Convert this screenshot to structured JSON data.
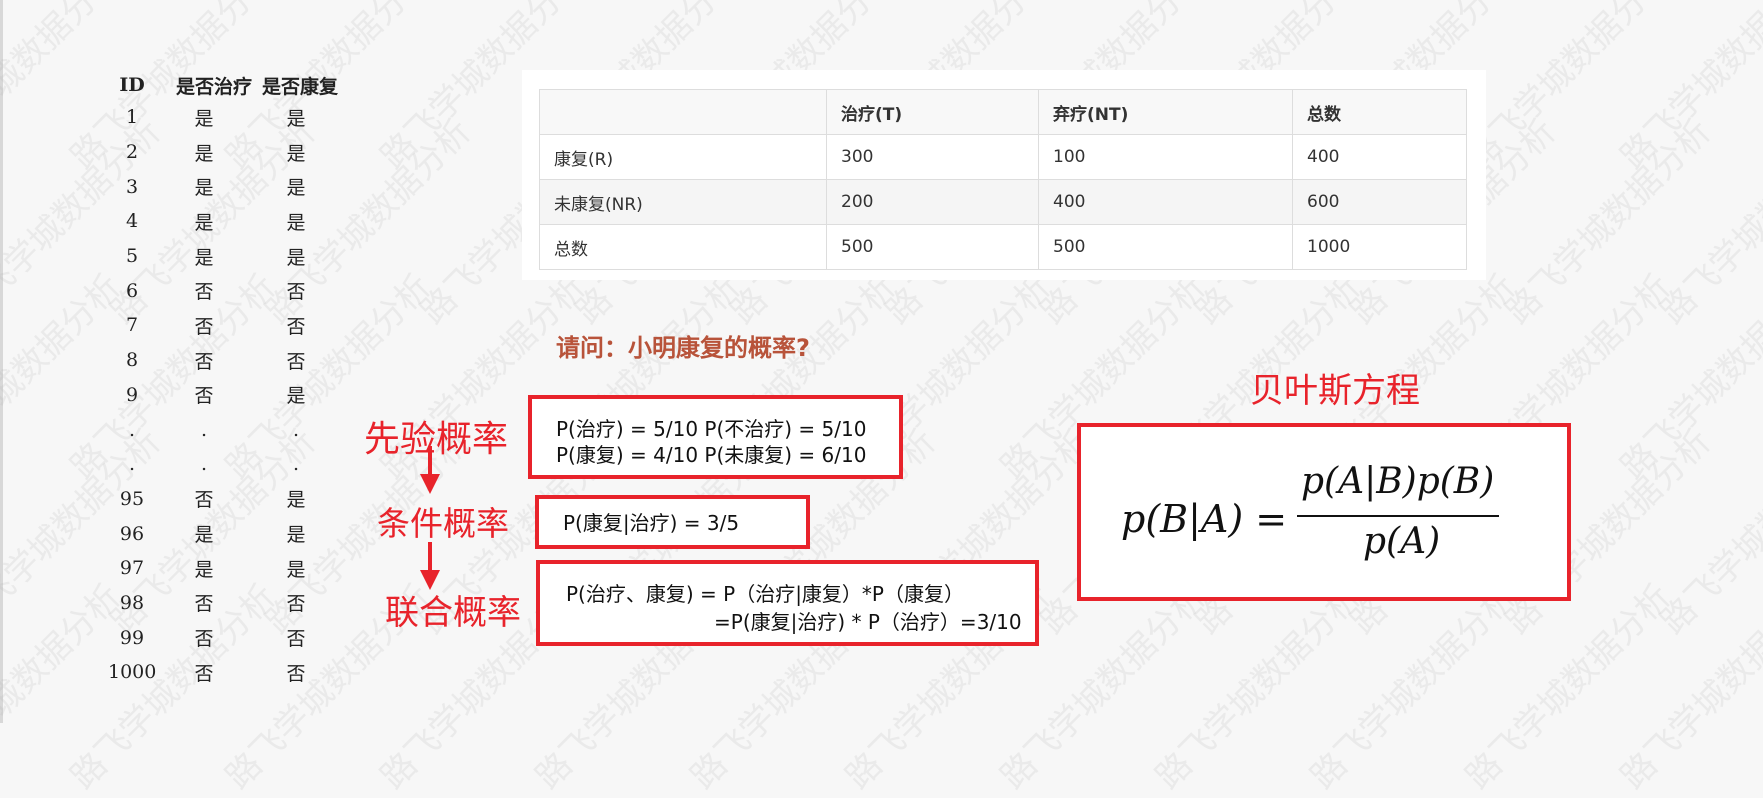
{
  "id_table": {
    "headers": [
      "ID",
      "是否治疗",
      "是否康复"
    ],
    "rows": [
      [
        "1",
        "是",
        "是"
      ],
      [
        "2",
        "是",
        "是"
      ],
      [
        "3",
        "是",
        "是"
      ],
      [
        "4",
        "是",
        "是"
      ],
      [
        "5",
        "是",
        "是"
      ],
      [
        "6",
        "否",
        "否"
      ],
      [
        "7",
        "否",
        "否"
      ],
      [
        "8",
        "否",
        "否"
      ],
      [
        "9",
        "否",
        "是"
      ],
      [
        ".",
        ".",
        "."
      ],
      [
        ".",
        ".",
        "."
      ],
      [
        "95",
        "否",
        "是"
      ],
      [
        "96",
        "是",
        "是"
      ],
      [
        "97",
        "是",
        "是"
      ],
      [
        "98",
        "否",
        "否"
      ],
      [
        "99",
        "否",
        "否"
      ],
      [
        "1000",
        "否",
        "否"
      ]
    ]
  },
  "contingency": {
    "headers": [
      "",
      "治疗(T)",
      "弃疗(NT)",
      "总数"
    ],
    "rows": [
      [
        "康复(R)",
        "300",
        "100",
        "400"
      ],
      [
        "未康复(NR)",
        "200",
        "400",
        "600"
      ],
      [
        "总数",
        "500",
        "500",
        "1000"
      ]
    ]
  },
  "question": "请问：小明康复的概率?",
  "labels": {
    "prior": "先验概率",
    "conditional": "条件概率",
    "joint": "联合概率",
    "bayes_title": "贝叶斯方程"
  },
  "prior_box": {
    "line1": "P(治疗) = 5/10    P(不治疗) = 5/10",
    "line2": "P(康复) = 4/10   P(未康复) = 6/10"
  },
  "conditional_box": {
    "line1": "P(康复|治疗) = 3/5"
  },
  "joint_box": {
    "line1": "P(治疗、康复) = P（治疗|康复）*P（康复）",
    "line2": "=P(康复|治疗) * P（治疗）=3/10"
  },
  "formula": {
    "lhs": "p(B|A) =",
    "numerator": "p(A|B)p(B)",
    "denominator": "p(A)"
  },
  "watermark": "路飞学城数据分析",
  "colors": {
    "accent_red": "#e8232b",
    "question_color": "#b8533a"
  }
}
